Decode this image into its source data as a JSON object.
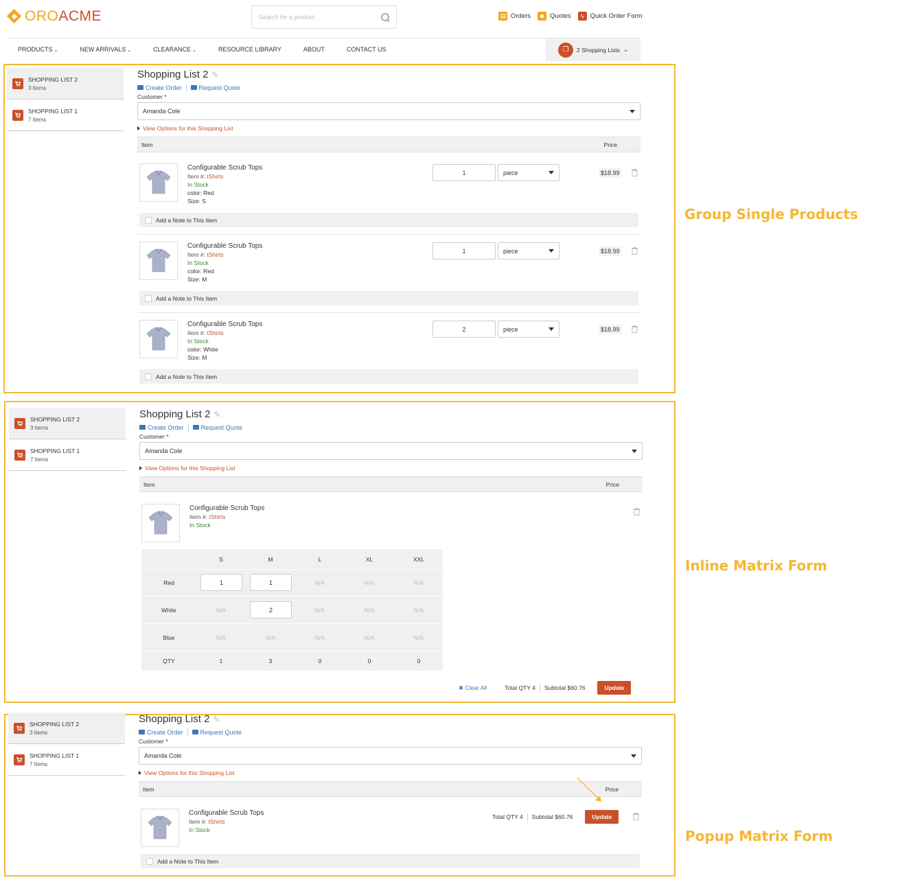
{
  "header": {
    "logo_oro": "ORO",
    "logo_acme": "ACME",
    "search_placeholder": "Search for a product",
    "links": [
      {
        "label": "Orders",
        "icon": "orders-icon",
        "color": "#f0a81c"
      },
      {
        "label": "Quotes",
        "icon": "quotes-icon",
        "color": "#f0a81c"
      },
      {
        "label": "Quick Order Form",
        "icon": "quick-order-icon",
        "color": "#c9502a"
      }
    ],
    "nav": [
      "PRODUCTS",
      "NEW ARRIVALS",
      "CLEARANCE",
      "RESOURCE LIBRARY",
      "ABOUT",
      "CONTACT US"
    ],
    "shopping_lists_button": "2 Shopping Lists"
  },
  "common": {
    "lists": [
      {
        "name": "SHOPPING LIST 2",
        "count": "3 Items"
      },
      {
        "name": "SHOPPING LIST 1",
        "count": "7 Items"
      }
    ],
    "title": "Shopping List 2",
    "create_order": "Create Order",
    "request_quote": "Request Quote",
    "customer_label": "Customer *",
    "customer_value": "Amanda Cole",
    "view_options": "View Options for this Shopping List",
    "col_item": "Item",
    "col_price": "Price",
    "note_label": "Add a Note to This Item",
    "product_name": "Configurable Scrub Tops",
    "item_prefix": "Item #:",
    "sku": "tShirts",
    "in_stock": "In Stock",
    "unit": "piece",
    "price": "$18.99"
  },
  "panel1": {
    "label": "Group Single Products",
    "rows": [
      {
        "color": "color: Red",
        "size": "Size: S",
        "qty": "1"
      },
      {
        "color": "color: Red",
        "size": "Size: M",
        "qty": "1"
      },
      {
        "color": "color: White",
        "size": "Size: M",
        "qty": "2"
      }
    ]
  },
  "panel2": {
    "label": "Inline Matrix Form",
    "columns": [
      "S",
      "M",
      "L",
      "XL",
      "XXL"
    ],
    "rows": [
      {
        "label": "Red",
        "cells": [
          "1",
          "1",
          "N/A",
          "N/A",
          "N/A"
        ]
      },
      {
        "label": "White",
        "cells": [
          "N/A",
          "2",
          "N/A",
          "N/A",
          "N/A"
        ]
      },
      {
        "label": "Blue",
        "cells": [
          "N/A",
          "N/A",
          "N/A",
          "N/A",
          "N/A"
        ]
      }
    ],
    "qty_label": "QTY",
    "qty_totals": [
      "1",
      "3",
      "0",
      "0",
      "0"
    ],
    "clear_all": "Clear All",
    "total_qty": "Total QTY 4",
    "subtotal": "Subtotal $60.76",
    "update": "Update"
  },
  "panel3": {
    "label": "Popup Matrix Form",
    "total_qty": "Total QTY 4",
    "subtotal": "Subtotal $60.76",
    "update": "Update"
  },
  "colors": {
    "accent": "#c9502a",
    "highlight": "#f5b731",
    "link": "#3a7ab8",
    "stock": "#2e8b2e"
  }
}
